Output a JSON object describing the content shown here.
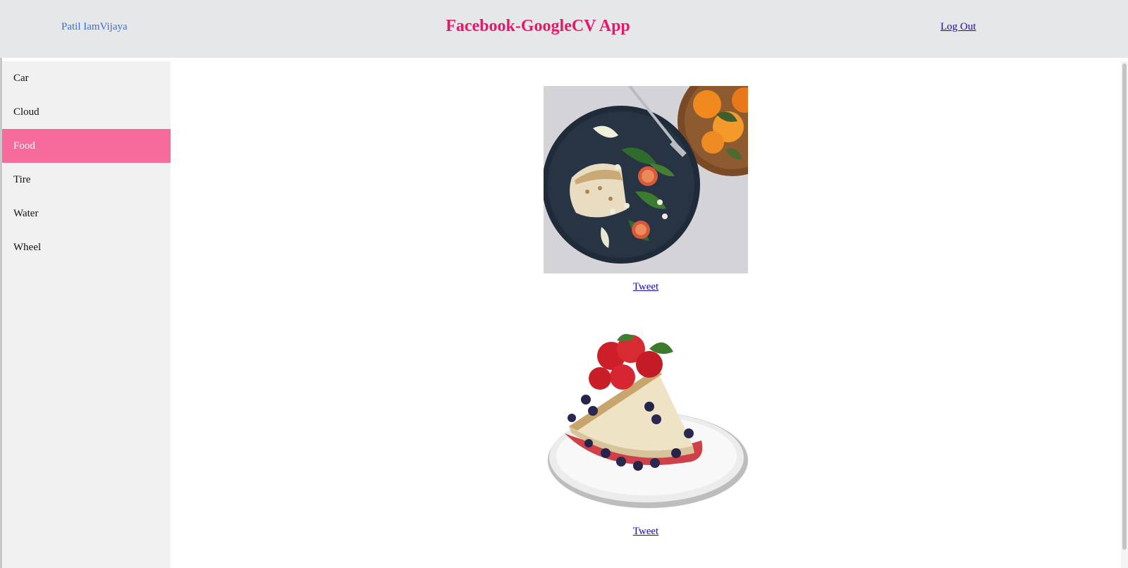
{
  "header": {
    "user_name": "Patil IamVijaya",
    "title": "Facebook-GoogleCV App",
    "logout_label": "Log Out"
  },
  "sidebar": {
    "items": [
      {
        "label": "Car",
        "active": false
      },
      {
        "label": "Cloud",
        "active": false
      },
      {
        "label": "Food",
        "active": true
      },
      {
        "label": "Tire",
        "active": false
      },
      {
        "label": "Water",
        "active": false
      },
      {
        "label": "Wheel",
        "active": false
      }
    ]
  },
  "main": {
    "posts": [
      {
        "image": "plated-fish-salad-photo",
        "tweet_label": "Tweet"
      },
      {
        "image": "berry-cheesecake-photo",
        "tweet_label": "Tweet"
      }
    ]
  },
  "colors": {
    "header_bg": "#e6e7e9",
    "title": "#e8176c",
    "active_item": "#f66b9c",
    "link": "#1a0dab",
    "user_name": "#3a6fd8"
  }
}
